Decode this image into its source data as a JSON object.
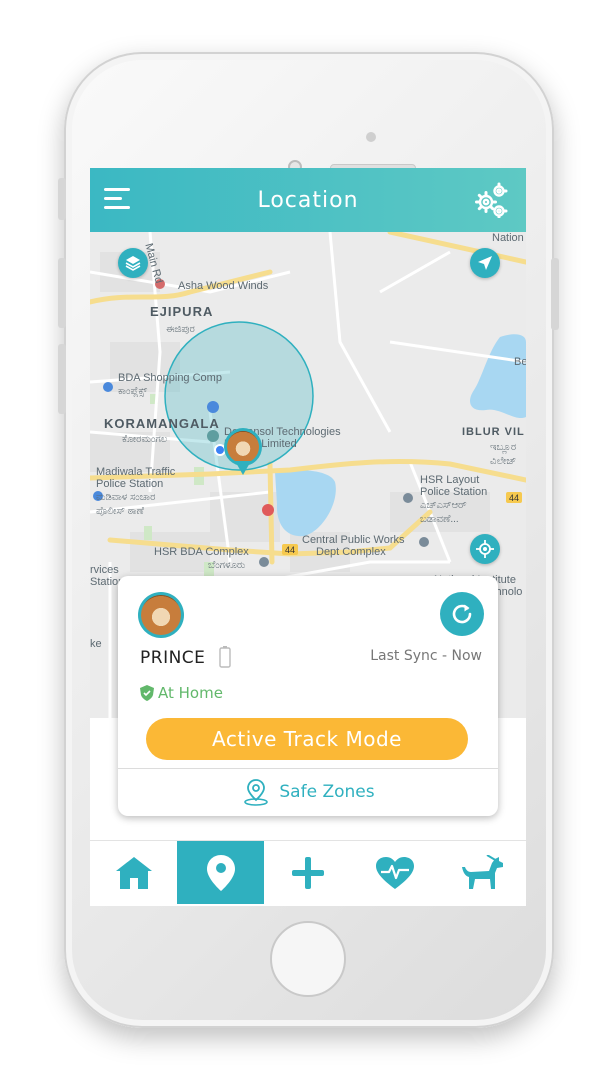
{
  "header": {
    "title": "Location"
  },
  "map": {
    "labels": {
      "main_rd": "Main Rd",
      "asha_wood": "Asha Wood Winds",
      "ejipura": "EJIPURA",
      "ejipura_kn": "ಈಜಿಪುರ",
      "bda_shopping": "BDA Shopping Comp",
      "bda_shopping_kn": "ಕಾಂಪ್ಲೆಕ್ಸ್",
      "koramangala": "KORAMANGALA",
      "koramangala_kn": "ಕೋರಮಂಗಲ",
      "demansol": "Demansol Technologies",
      "demansol2": "Private Limited",
      "madiwala1": "Madiwala Traffic",
      "madiwala2": "Police Station",
      "madiwala_kn1": "ಮಡಿವಾಳ ಸಂಚಾರ",
      "madiwala_kn2": "ಪೊಲೀಸ್ ಠಾಣೆ",
      "iblur": "IBLUR VIL",
      "iblur_kn1": "ಇಬ್ಲೂರ",
      "iblur_kn2": "ವಿಲೇಜ್",
      "hsr_layout1": "HSR Layout",
      "hsr_layout2": "Police Station",
      "hsr_kn1": "ಎಚ್‌ಎಸ್‌ಆರ್",
      "hsr_kn2": "ಬಡಾವಣೆ...",
      "central_pw1": "Central Public Works",
      "central_pw2": "Dept Complex",
      "hsr_bda": "HSR BDA Complex",
      "hsr_bda_kn": "ಬೆಂಗಳೂರು",
      "rvices": "rvices",
      "station": "Station",
      "ke": "ke",
      "national1": "National Institute",
      "national2": "chnolo",
      "nation_top": "Nation",
      "be": "Be",
      "road_44a": "44",
      "road_44b": "44"
    }
  },
  "card": {
    "pet_name": "PRINCE",
    "sync_text": "Last Sync - Now",
    "status": "At Home",
    "track_button": "Active Track Mode",
    "safe_zones": "Safe Zones"
  },
  "nav": {
    "items": [
      "home-icon",
      "location-pin-icon",
      "plus-icon",
      "heart-rate-icon",
      "dog-icon"
    ],
    "active": "location-pin-icon"
  },
  "colors": {
    "accent": "#2fb0bf",
    "header_gradient_start": "#3bb8c3",
    "header_gradient_end": "#5ec9c4",
    "track_button": "#fbb836",
    "status_green": "#62b86b"
  }
}
